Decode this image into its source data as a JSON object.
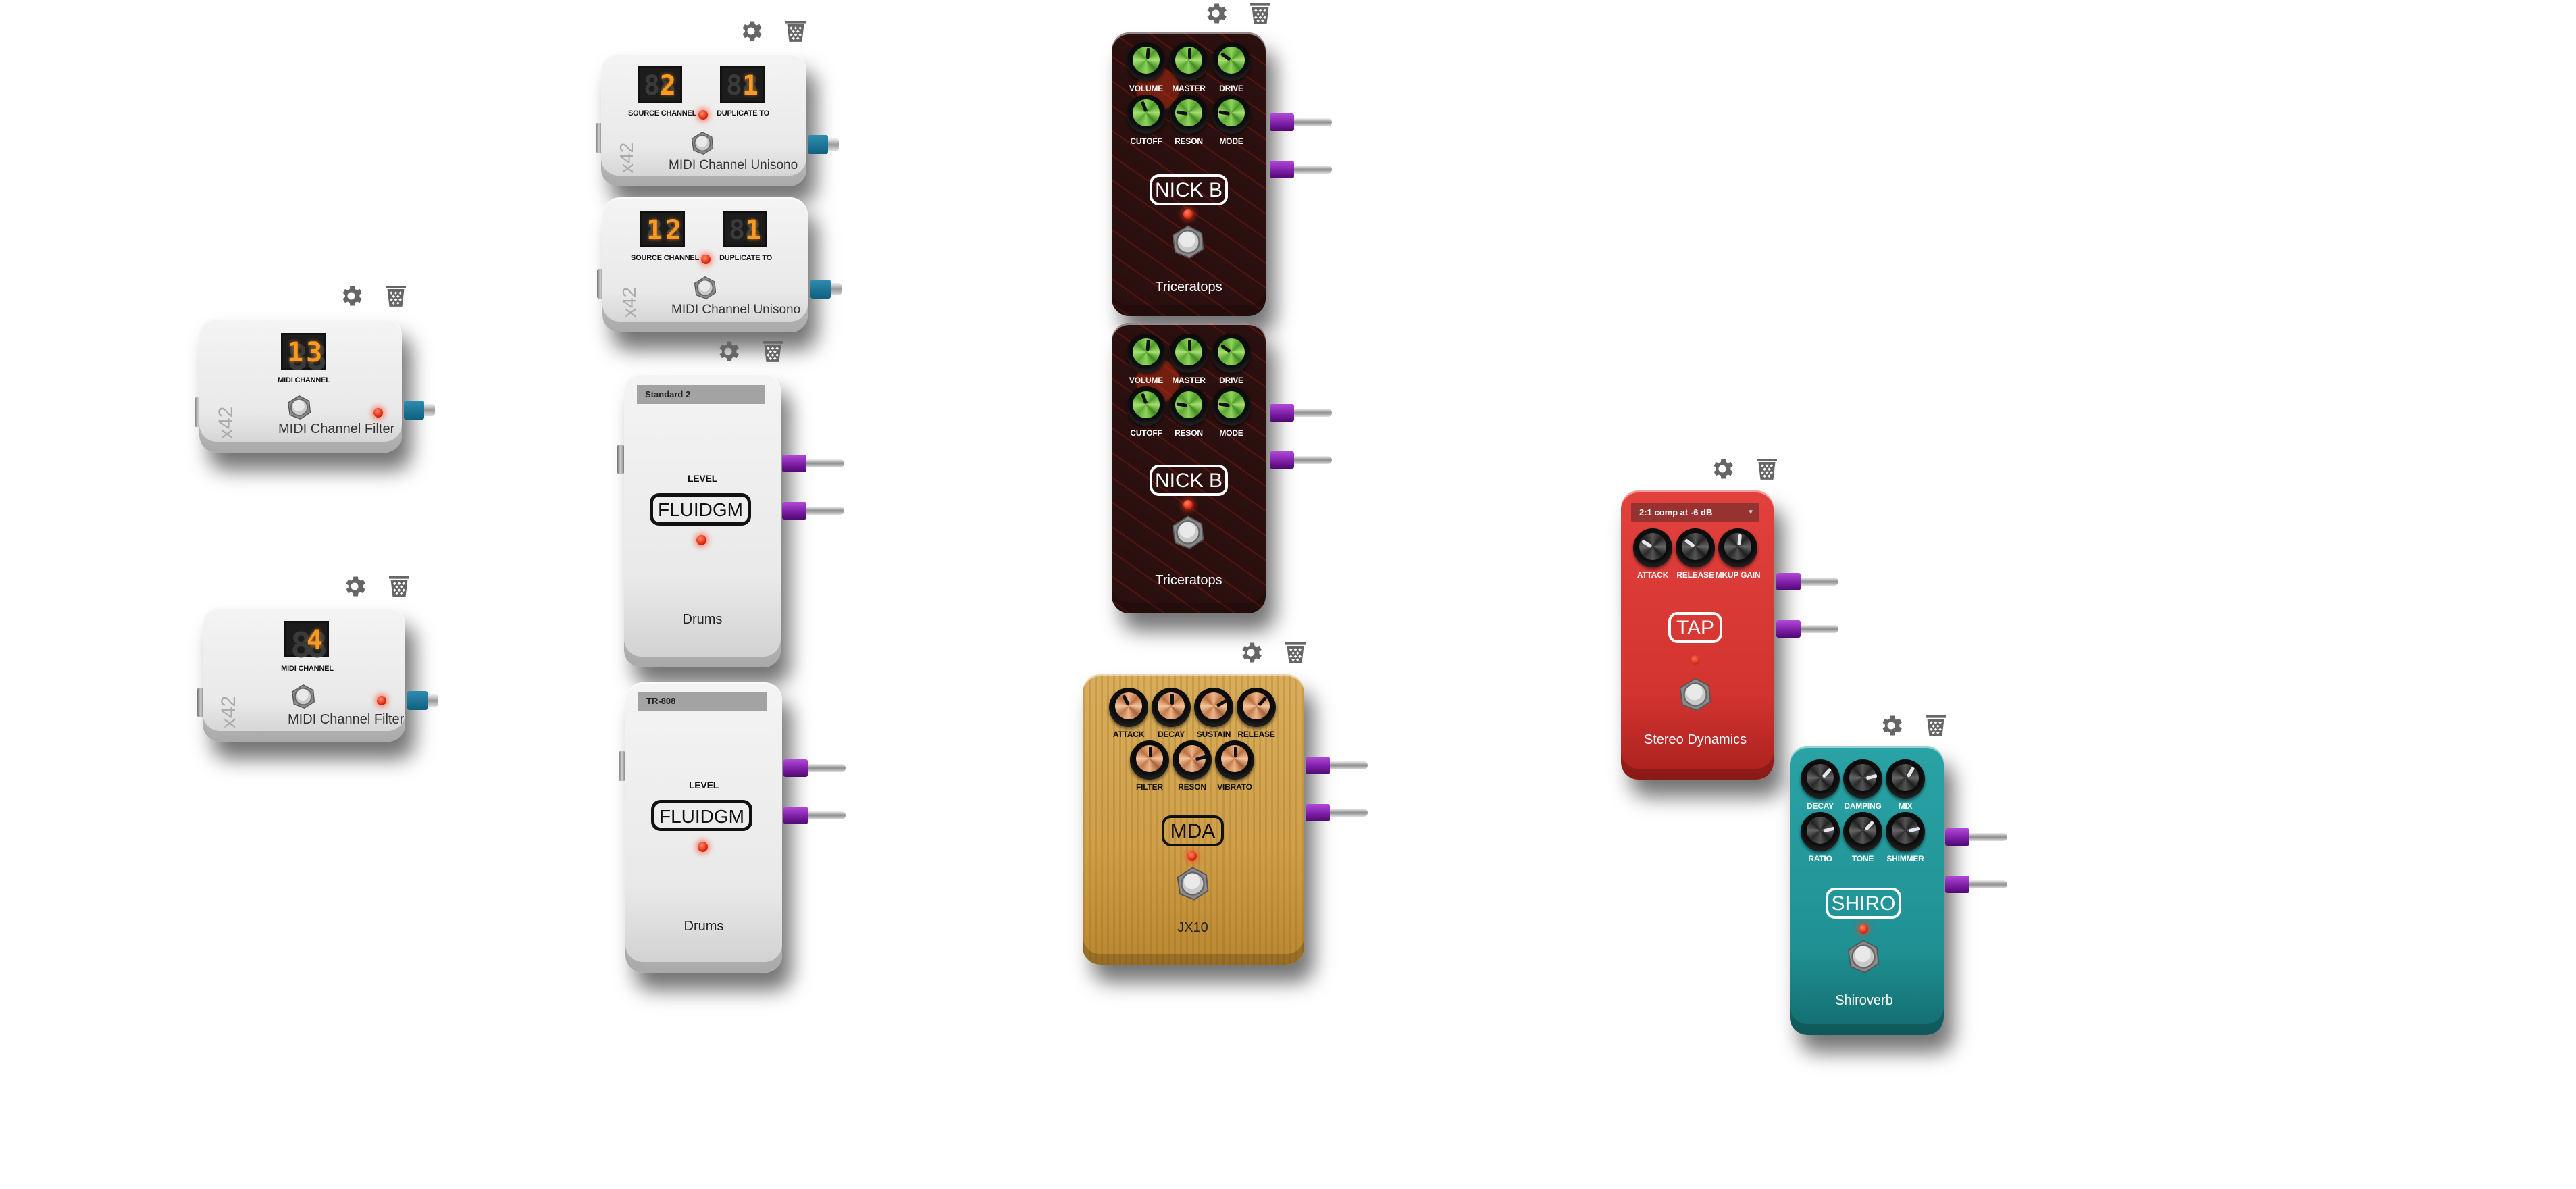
{
  "toolbar_icons": {
    "settings": "gear-icon",
    "remove": "trash-icon"
  },
  "pedals": {
    "filter1": {
      "brand_label": "x42",
      "display_label": "MIDI CHANNEL",
      "display": [
        "1",
        "3"
      ],
      "name": "MIDI Channel Filter",
      "led_on": true
    },
    "filter2": {
      "brand_label": "x42",
      "display_label": "MIDI CHANNEL",
      "display": [
        "",
        "4"
      ],
      "name": "MIDI Channel Filter",
      "led_on": true
    },
    "unisono1": {
      "brand_label": "x42",
      "source_label": "SOURCE CHANNEL",
      "dup_label": "DUPLICATE TO",
      "source": [
        "",
        "2"
      ],
      "dup": [
        "",
        "1"
      ],
      "name": "MIDI Channel Unisono",
      "led_on": true
    },
    "unisono2": {
      "brand_label": "x42",
      "source_label": "SOURCE CHANNEL",
      "dup_label": "DUPLICATE TO",
      "source": [
        "1",
        "2"
      ],
      "dup": [
        "",
        "1"
      ],
      "name": "MIDI Channel Unisono",
      "led_on": true
    },
    "fluid1": {
      "preset": "Standard 2",
      "knob_label": "LEVEL",
      "brand": "FLUIDGM",
      "name": "Drums",
      "led_on": true
    },
    "fluid2": {
      "preset": "TR-808",
      "knob_label": "LEVEL",
      "brand": "FLUIDGM",
      "name": "Drums",
      "led_on": true
    },
    "nickb1": {
      "brand": "NICK B",
      "name": "Triceratops",
      "led_on": true,
      "knobs": [
        {
          "label": "VOLUME",
          "value": 0.52
        },
        {
          "label": "MASTER",
          "value": 0.5
        },
        {
          "label": "DRIVE",
          "value": 0.3
        },
        {
          "label": "CUTOFF",
          "value": 0.42
        },
        {
          "label": "RESON",
          "value": 0.2
        },
        {
          "label": "MODE",
          "value": 0.2
        }
      ]
    },
    "nickb2": {
      "brand": "NICK B",
      "name": "Triceratops",
      "led_on": true,
      "knobs": [
        {
          "label": "VOLUME",
          "value": 0.52
        },
        {
          "label": "MASTER",
          "value": 0.5
        },
        {
          "label": "DRIVE",
          "value": 0.3
        },
        {
          "label": "CUTOFF",
          "value": 0.42
        },
        {
          "label": "RESON",
          "value": 0.2
        },
        {
          "label": "MODE",
          "value": 0.2
        }
      ]
    },
    "mda": {
      "brand": "MDA",
      "name": "JX10",
      "led_on": true,
      "knobs": [
        {
          "label": "ATTACK",
          "value": 0.4
        },
        {
          "label": "DECAY",
          "value": 0.5
        },
        {
          "label": "SUSTAIN",
          "value": 0.72
        },
        {
          "label": "RELEASE",
          "value": 0.65
        },
        {
          "label": "FILTER",
          "value": 0.5
        },
        {
          "label": "RESON",
          "value": 0.78
        },
        {
          "label": "VIBRATO",
          "value": 0.5
        }
      ]
    },
    "tap": {
      "preset": "2:1 comp at -6 dB",
      "preset_arrow": "▼",
      "brand": "TAP",
      "name": "Stereo Dynamics",
      "led_on": false,
      "knobs": [
        {
          "label": "ATTACK",
          "value": 0.28
        },
        {
          "label": "RELEASE",
          "value": 0.3
        },
        {
          "label": "MKUP GAIN",
          "value": 0.52
        }
      ]
    },
    "shiro": {
      "brand": "SHIRO",
      "name": "Shiroverb",
      "led_on": true,
      "knobs": [
        {
          "label": "DECAY",
          "value": 0.66
        },
        {
          "label": "DAMPING",
          "value": 0.78
        },
        {
          "label": "MIX",
          "value": 0.62
        },
        {
          "label": "RATIO",
          "value": 0.78
        },
        {
          "label": "TONE",
          "value": 0.66
        },
        {
          "label": "SHIMMER",
          "value": 0.78
        }
      ]
    }
  },
  "colors": {
    "led": "#e02a10",
    "segment_on": "#ff9a1f",
    "cable_purple": "#7a1ba3",
    "cable_teal": "#0f5f7f",
    "nickb_knob": "#6abf3c",
    "mda_knob": "#d8935e",
    "tap_body": "#d33430",
    "shiro_body": "#1f9194",
    "mda_body": "#cf9f48"
  }
}
